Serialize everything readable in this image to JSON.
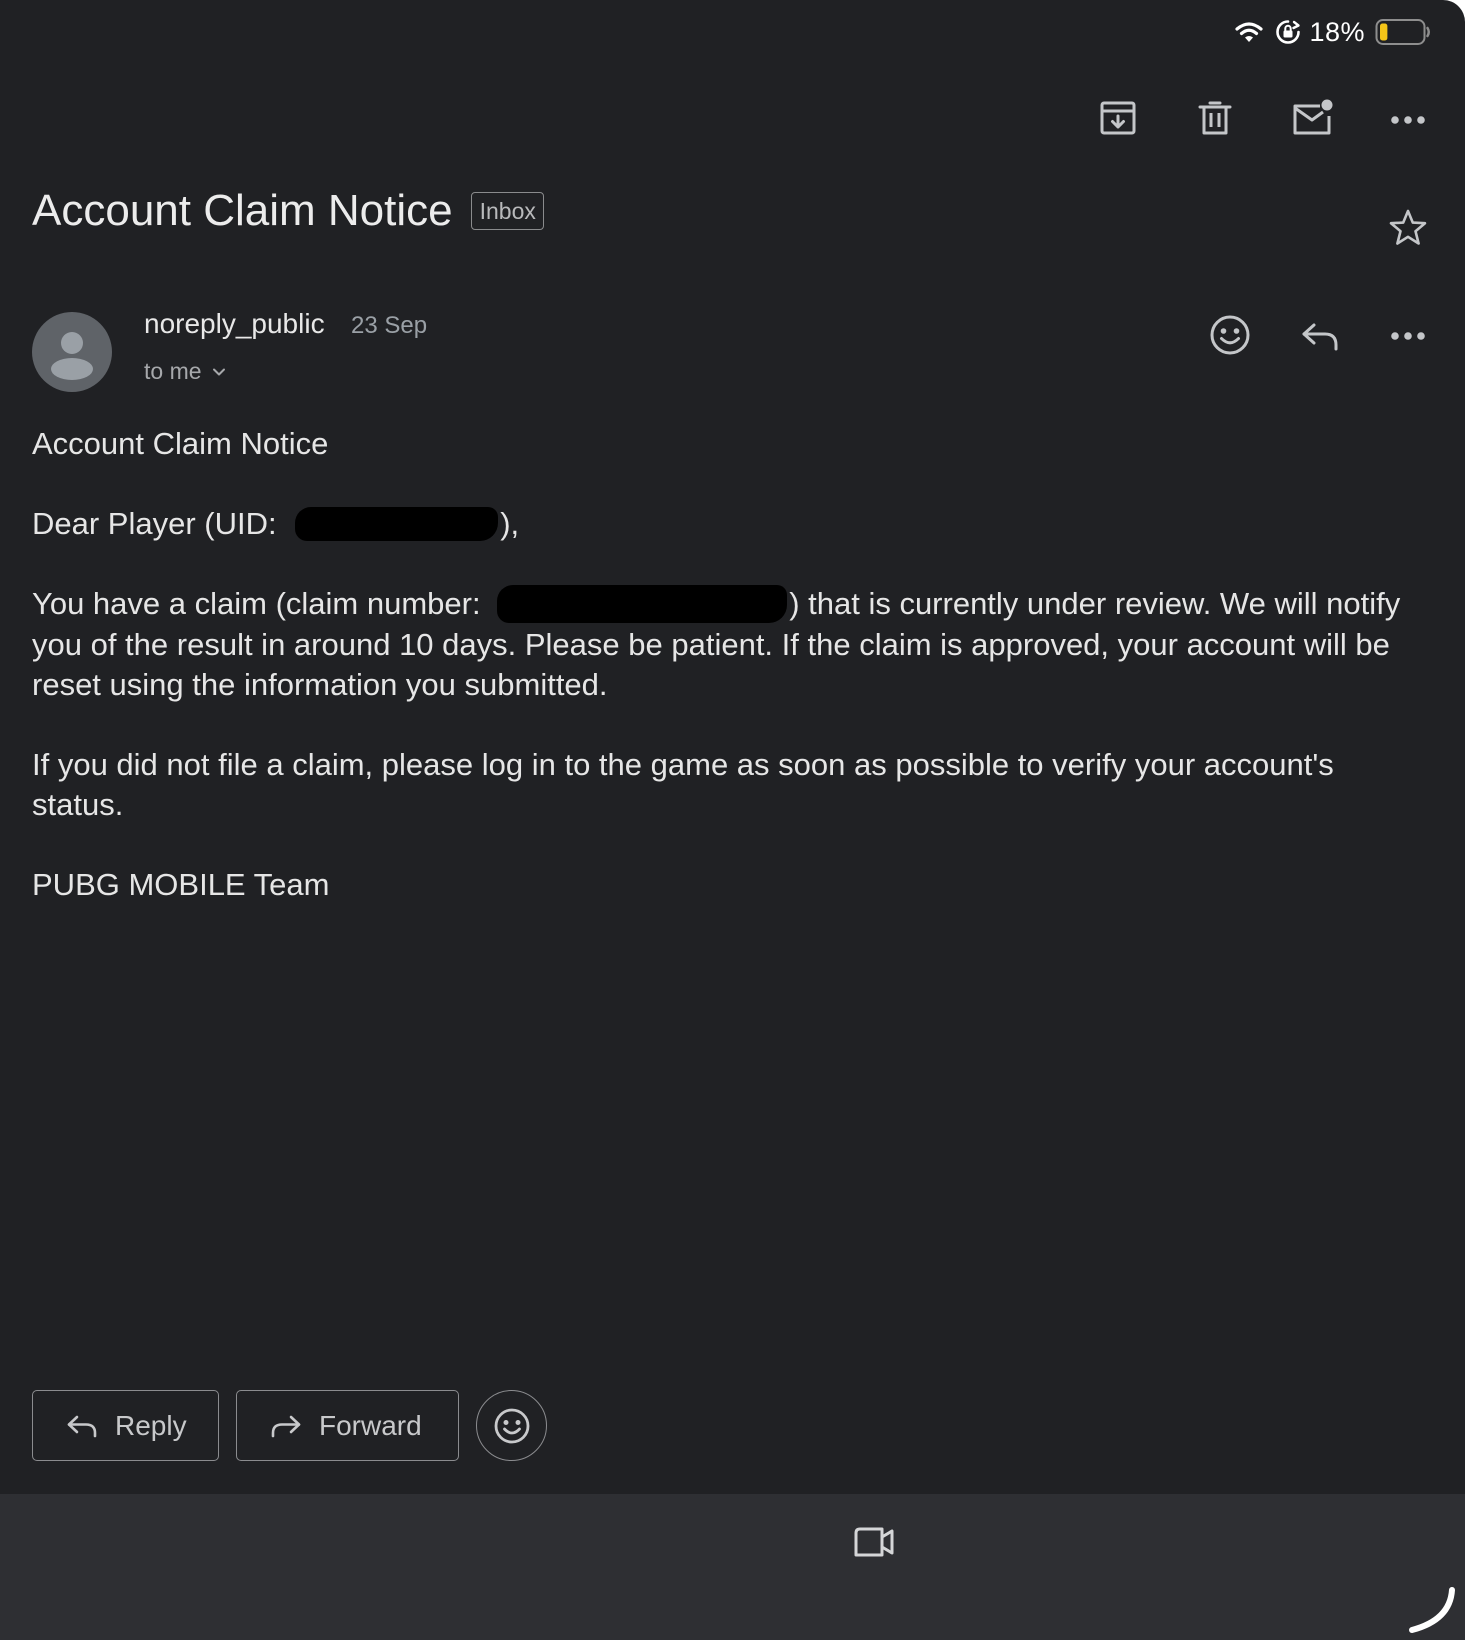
{
  "status_bar": {
    "wifi_icon": "wifi-icon",
    "lock_icon": "rotation-lock-icon",
    "battery_percent": "18%",
    "battery_level": 0.18,
    "battery_color": "#f5c518"
  },
  "toolbar": {
    "archive_icon": "archive-icon",
    "delete_icon": "trash-icon",
    "mark_unread_icon": "mark-unread-icon",
    "more_icon": "more-icon"
  },
  "email": {
    "subject": "Account Claim Notice",
    "label": "Inbox",
    "starred": false,
    "sender": "noreply_public",
    "date": "23 Sep",
    "recipient": "to me",
    "body": {
      "heading": "Account Claim Notice",
      "greeting_prefix": "Dear Player (UID: ",
      "greeting_suffix": "),",
      "claim_prefix": "You have a claim (claim number: ",
      "claim_suffix": ") that is currently under review. We will notify you of the result in around 10 days. Please be patient. If the claim is approved, your account will be reset using the information you submitted.",
      "warning": "If you did not file a claim, please log in to the game as soon as possible to verify your account's status.",
      "signature": "PUBG MOBILE Team"
    }
  },
  "actions": {
    "reply_label": "Reply",
    "forward_label": "Forward"
  },
  "colors": {
    "background": "#202124",
    "bottom_bar": "#2e2f33",
    "text": "#e3e3e3",
    "muted": "#9aa0a6"
  }
}
